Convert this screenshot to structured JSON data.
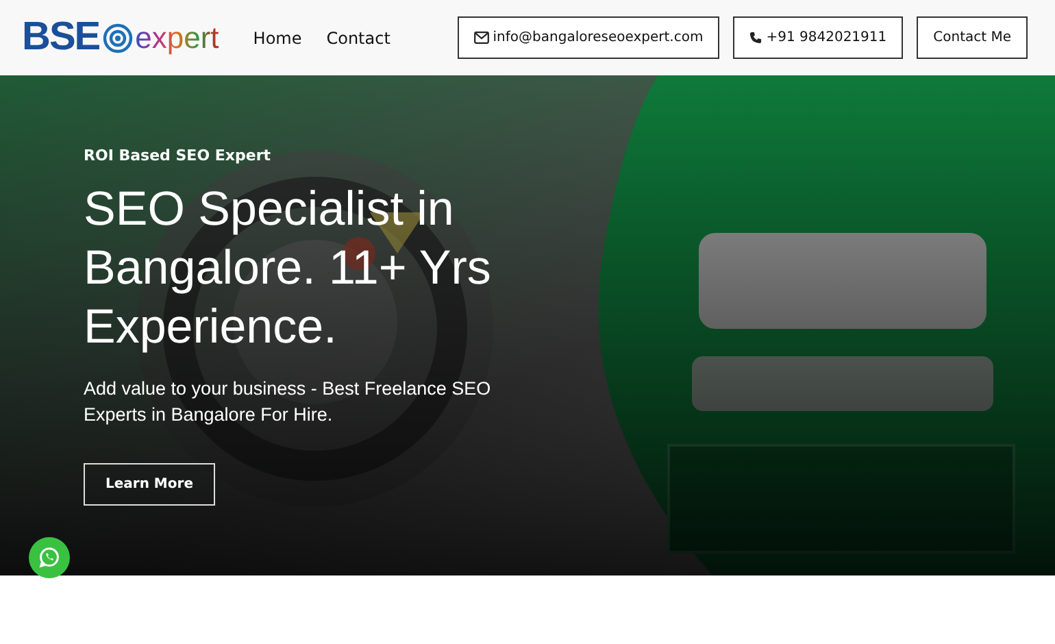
{
  "header": {
    "logo": {
      "part_1": "BSE",
      "part_2": "expert"
    },
    "nav": [
      {
        "label": "Home"
      },
      {
        "label": "Contact"
      }
    ],
    "actions": [
      {
        "kind": "email",
        "label": "info@bangaloreseoexpert.com"
      },
      {
        "kind": "phone",
        "label": "+91 9842021911"
      },
      {
        "kind": "plain",
        "label": "Contact Me"
      }
    ]
  },
  "hero": {
    "eyebrow": "ROI Based SEO Expert",
    "title": "SEO Specialist in Bangalore. 11+ Yrs Experience.",
    "subtitle": "Add value to your business - Best Freelance SEO Experts in Bangalore For Hire.",
    "button": "Learn More"
  }
}
